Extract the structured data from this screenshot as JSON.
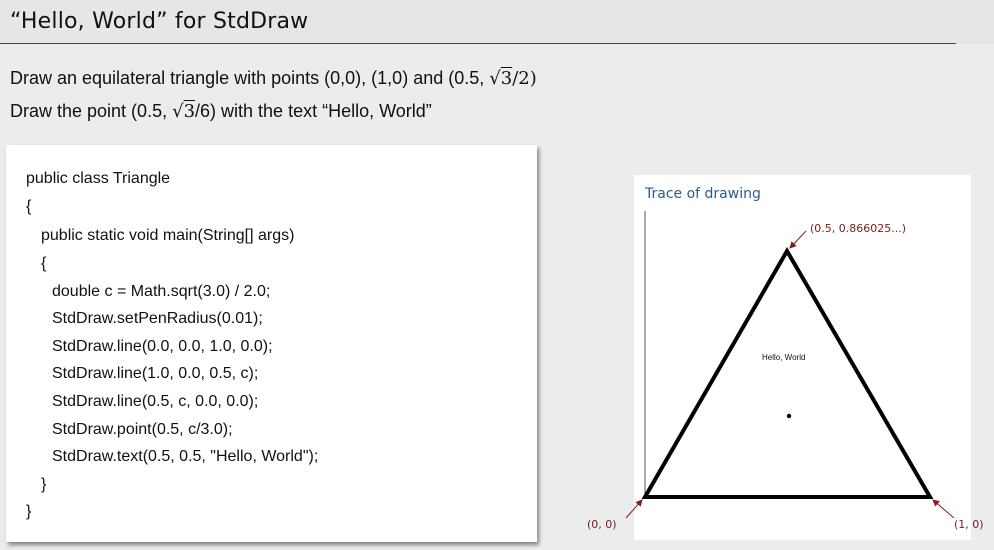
{
  "slide": {
    "title": "“Hello, World” for StdDraw"
  },
  "description": {
    "line1_prefix": "Draw an equilateral triangle with points (0,0), (1,0) and (0.5, ",
    "line1_sqrt_symbol": "√",
    "line1_sqrt_arg": "3",
    "line1_suffix": "/2)",
    "line2_prefix": "Draw the point (0.5, ",
    "line2_sqrt_symbol": "√",
    "line2_sqrt_arg": "3",
    "line2_suffix": "/6) with the text “Hello, World”"
  },
  "code": {
    "lines": [
      "public class Triangle",
      "{",
      "public static void main(String[] args)",
      "{",
      "double c = Math.sqrt(3.0) / 2.0;",
      "StdDraw.setPenRadius(0.01);",
      "StdDraw.line(0.0, 0.0, 1.0, 0.0);",
      "StdDraw.line(1.0, 0.0, 0.5, c);",
      "StdDraw.line(0.5, c, 0.0, 0.0);",
      "StdDraw.point(0.5, c/3.0);",
      "StdDraw.text(0.5, 0.5, \"Hello, World\");",
      "}",
      "}"
    ]
  },
  "trace": {
    "title": "Trace of drawing",
    "label_origin": "(0, 0)",
    "label_right": "(1, 0)",
    "label_top": "(0.5, 0.866025...)",
    "hello_text": "Hello, World",
    "colors": {
      "title": "#2b5c8a",
      "coord_labels": "#7a1a1a",
      "arrows": "#8b1a1a",
      "triangle": "#000000"
    }
  }
}
